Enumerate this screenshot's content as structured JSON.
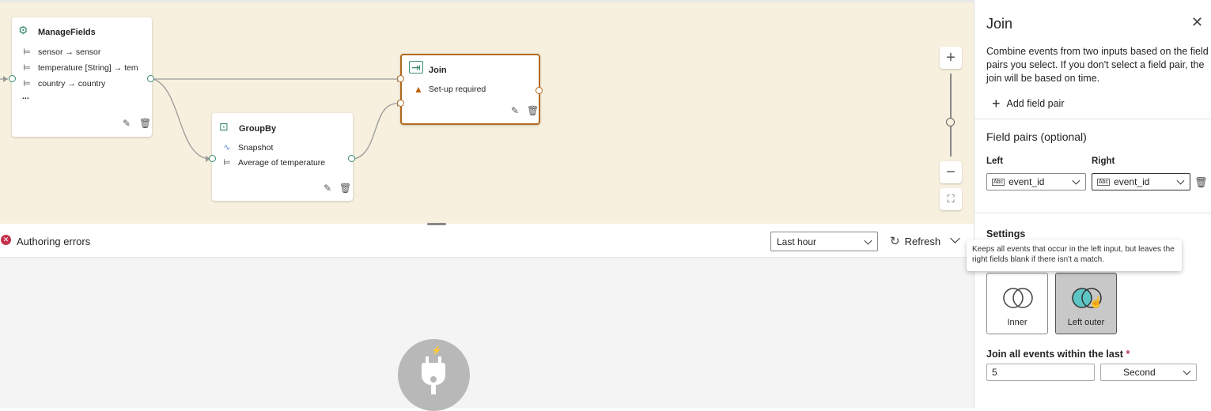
{
  "canvas": {
    "nodes": {
      "manage_fields": {
        "title": "ManageFields",
        "icon": "gear-icon",
        "rows": [
          "sensor → sensor",
          "temperature [String] → tem",
          "country → country"
        ],
        "more": "..."
      },
      "group_by": {
        "title": "GroupBy",
        "icon": "groupby-icon",
        "rows": [
          "Snapshot",
          "Average of temperature"
        ]
      },
      "join": {
        "title": "Join",
        "icon": "join-icon",
        "status": "Set-up required",
        "status_icon": "warning-icon",
        "status_color": "#c4620a"
      }
    },
    "zoom": {
      "in": "+",
      "out": "−"
    }
  },
  "errors_bar": {
    "label": "Authoring errors",
    "time_range": "Last hour",
    "refresh": "Refresh"
  },
  "panel": {
    "title": "Join",
    "description": "Combine events from two inputs based on the field pairs you select. If you don't select a field pair, the join will be based on time.",
    "add_field_pair": "Add field pair",
    "field_pairs_title": "Field pairs (optional)",
    "left_label": "Left",
    "right_label": "Right",
    "left_value": "event_id",
    "right_value": "event_id",
    "settings_title": "Settings",
    "tooltip": "Keeps all events that occur in the left input, but leaves the right fields blank if there isn't a match.",
    "join_types": {
      "inner": "Inner",
      "left_outer": "Left outer",
      "selected": "Left outer"
    },
    "within_label": "Join all events within the last",
    "required_mark": "*",
    "within_value": "5",
    "within_unit": "Second"
  },
  "colors": {
    "canvas_bg": "#f7f0de",
    "port_green": "#3a8a74",
    "join_border": "#b36a1e",
    "error_red": "#c4314b",
    "selected_tile": "#c8c8c8",
    "venn_teal": "#5ec4c4"
  }
}
